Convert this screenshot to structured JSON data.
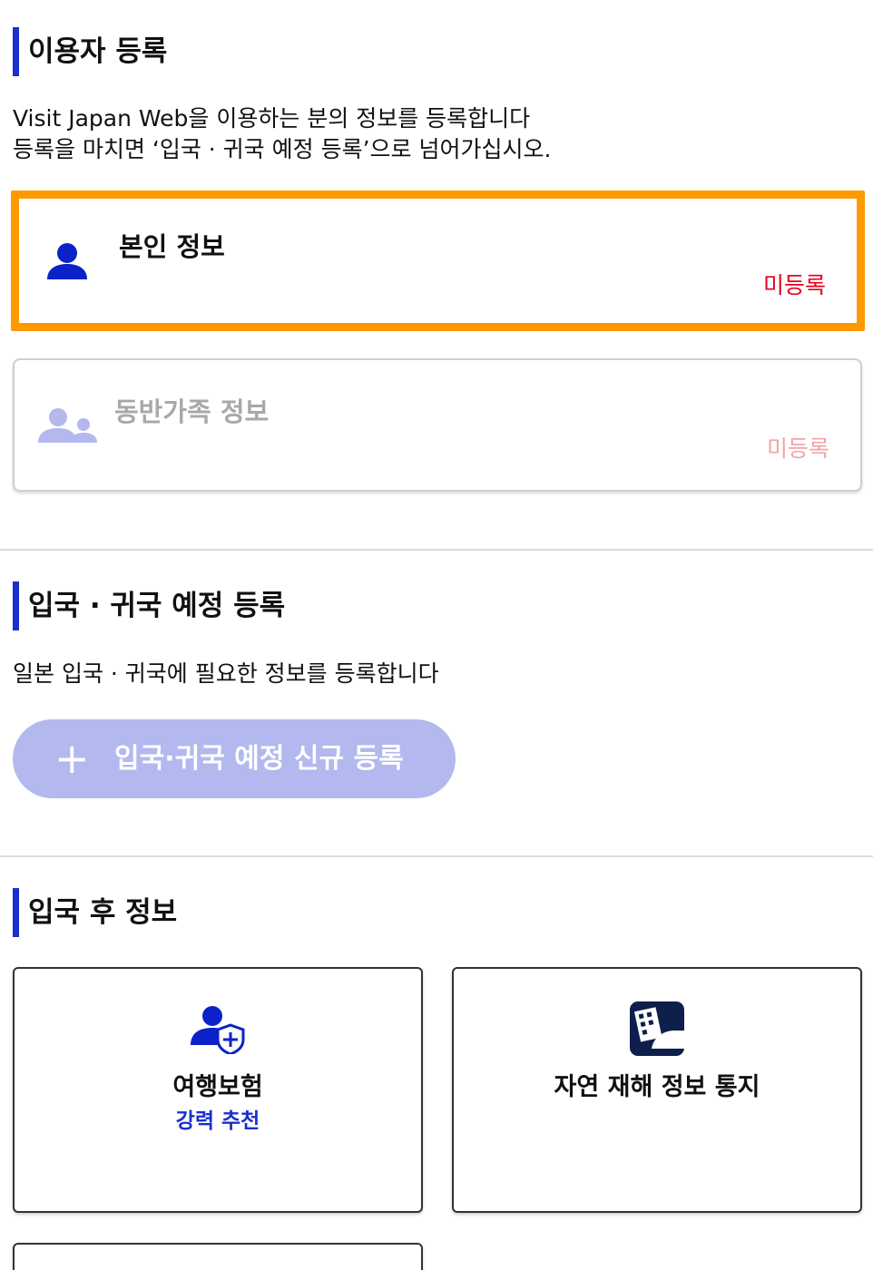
{
  "user_registration": {
    "title": "이용자 등록",
    "description_line1": "Visit Japan Web을 이용하는 분의 정보를 등록합니다",
    "description_line2": "등록을 마치면 ‘입국 · 귀국 예정 등록’으로 넘어가십시오.",
    "self_info": {
      "title": "본인 정보",
      "status": "미등록",
      "icon": "person-icon"
    },
    "companion_info": {
      "title": "동반가족 정보",
      "status": "미등록",
      "icon": "people-icon"
    }
  },
  "schedule_registration": {
    "title": "입국 · 귀국 예정 등록",
    "description": "일본 입국 · 귀국에 필요한 정보를 등록합니다",
    "add_button": {
      "icon": "+",
      "label": "입국·귀국 예정 신규 등록"
    }
  },
  "post_entry": {
    "title": "입국 후 정보",
    "tiles": [
      {
        "title": "여행보험",
        "subtitle": "강력 추천",
        "icon": "person-shield-icon"
      },
      {
        "title": "자연 재해 정보 통지",
        "icon": "disaster-building-icon"
      }
    ]
  },
  "colors": {
    "accent": "#1a2fcc",
    "highlight": "#ff9900",
    "status_red": "#e6001a",
    "button_disabled": "#b3b8ee"
  }
}
